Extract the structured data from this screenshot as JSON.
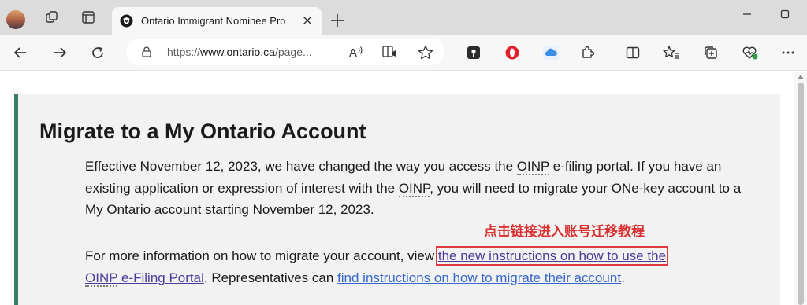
{
  "tab": {
    "title": "Ontario Immigrant Nominee Pro",
    "close_glyph": "×"
  },
  "toolbar": {
    "url_prefix": "https://",
    "url_domain": "www.ontario.ca",
    "url_suffix": "/page..."
  },
  "icons": [
    "profile-avatar",
    "workspaces-icon",
    "vertical-tabs-icon",
    "brave-favicon",
    "close-icon",
    "new-tab-icon",
    "minimize-icon",
    "maximize-icon",
    "back-icon",
    "forward-icon",
    "refresh-icon",
    "lock-icon",
    "read-aloud-icon",
    "immersive-reader-icon",
    "favorite-star-icon",
    "password-manager-icon",
    "opera-extension-icon",
    "cloud-extension-icon",
    "extensions-icon",
    "split-screen-icon",
    "favorites-icon",
    "collections-icon",
    "browser-essentials-icon",
    "more-menu-icon"
  ],
  "colors": {
    "accent_bar": "#3d7a6b",
    "link_visited": "#4a3d9a",
    "link": "#3768c9",
    "annotation_red": "#d93030"
  },
  "content": {
    "heading": "Migrate to a My Ontario Account",
    "p1": {
      "t1": "Effective November 12, 2023, we have changed the way you access the ",
      "abbr1": "OINP",
      "t2": " e-filing portal. If you have an existing application or expression of interest with the ",
      "abbr2": "OINP",
      "t3": ", you will need to migrate your ONe-key account to a My Ontario account starting November 12, 2023."
    },
    "annotation": "点击链接进入账号迁移教程",
    "p2": {
      "t1": "For more information on how to migrate your account, view ",
      "link1": "the new instructions on how to use the",
      "link1_abbr": "OINP",
      "link1_tail": " e-Filing Portal",
      "t2": ". Representatives can ",
      "link2": "find instructions on how to migrate their account",
      "t3": "."
    }
  }
}
